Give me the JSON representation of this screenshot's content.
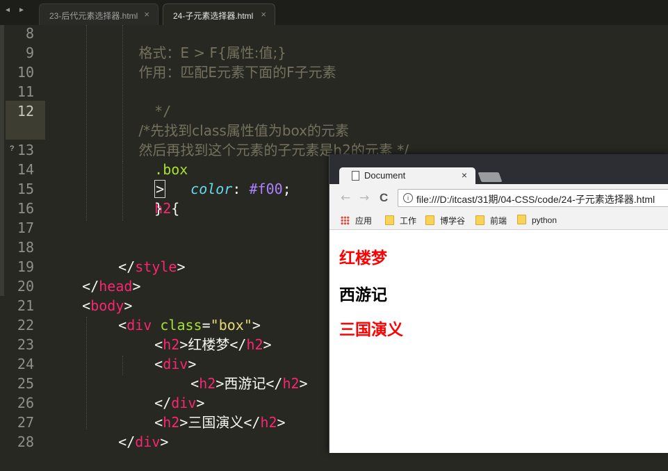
{
  "editor": {
    "nav_arrows": "◀ ▶",
    "tabs": [
      {
        "label": "23-后代元素选择器.html",
        "close": "×"
      },
      {
        "label": "24-子元素选择器.html",
        "close": "×"
      }
    ],
    "line_numbers": [
      "8",
      "9",
      "10",
      "11",
      "12",
      "13",
      "14",
      "15",
      "16",
      "17",
      "18",
      "19",
      "20",
      "21",
      "22",
      "23",
      "24",
      "25",
      "26",
      "27",
      "28"
    ],
    "modified_marker": "?",
    "code": {
      "l8": "格式：E > F{属性:值;}",
      "l9": "作用：匹配E元素下面的F子元素",
      "l11": "*/",
      "l12": "/*先找到class属性值为box的元素",
      "l13": "然后再找到这个元素的子元素是h2的元素 */",
      "l14_class": ".box",
      "l14_gt": ">",
      "l14_h2": "h2",
      "l14_brace": "{",
      "l15_prop": "color",
      "l15_colon": ": ",
      "l15_val": "#f00",
      "l15_semi": ";",
      "l16": "}",
      "lt": "<",
      "gt": ">",
      "lt_slash": "</",
      "tag_style": "style",
      "tag_head": "head",
      "tag_body": "body",
      "tag_div": "div",
      "tag_h2": "h2",
      "attr_class": "class",
      "eq": "=",
      "attr_val": "\"box\"",
      "text1": "红楼梦",
      "text2": "西游记",
      "text3": "三国演义"
    }
  },
  "browser": {
    "tab_title": "Document",
    "tab_close": "×",
    "back": "←",
    "forward": "→",
    "reload": "C",
    "info": "i",
    "url": "file:///D:/itcast/31期/04-CSS/code/24-子元素选择器.html",
    "bookmarks": [
      "应用",
      "工作",
      "博学谷",
      "前端",
      "python"
    ],
    "headings": [
      {
        "text": "红楼梦",
        "color": "#ff0000"
      },
      {
        "text": "西游记",
        "color": "#000000"
      },
      {
        "text": "三国演义",
        "color": "#ff0000"
      }
    ]
  },
  "colors": {
    "editor_bg": "#272822",
    "comment": "#75715e",
    "tag": "#f92672",
    "attribute": "#a6e22e",
    "string": "#e6db74",
    "property": "#66d9ef",
    "number": "#ae81ff"
  }
}
